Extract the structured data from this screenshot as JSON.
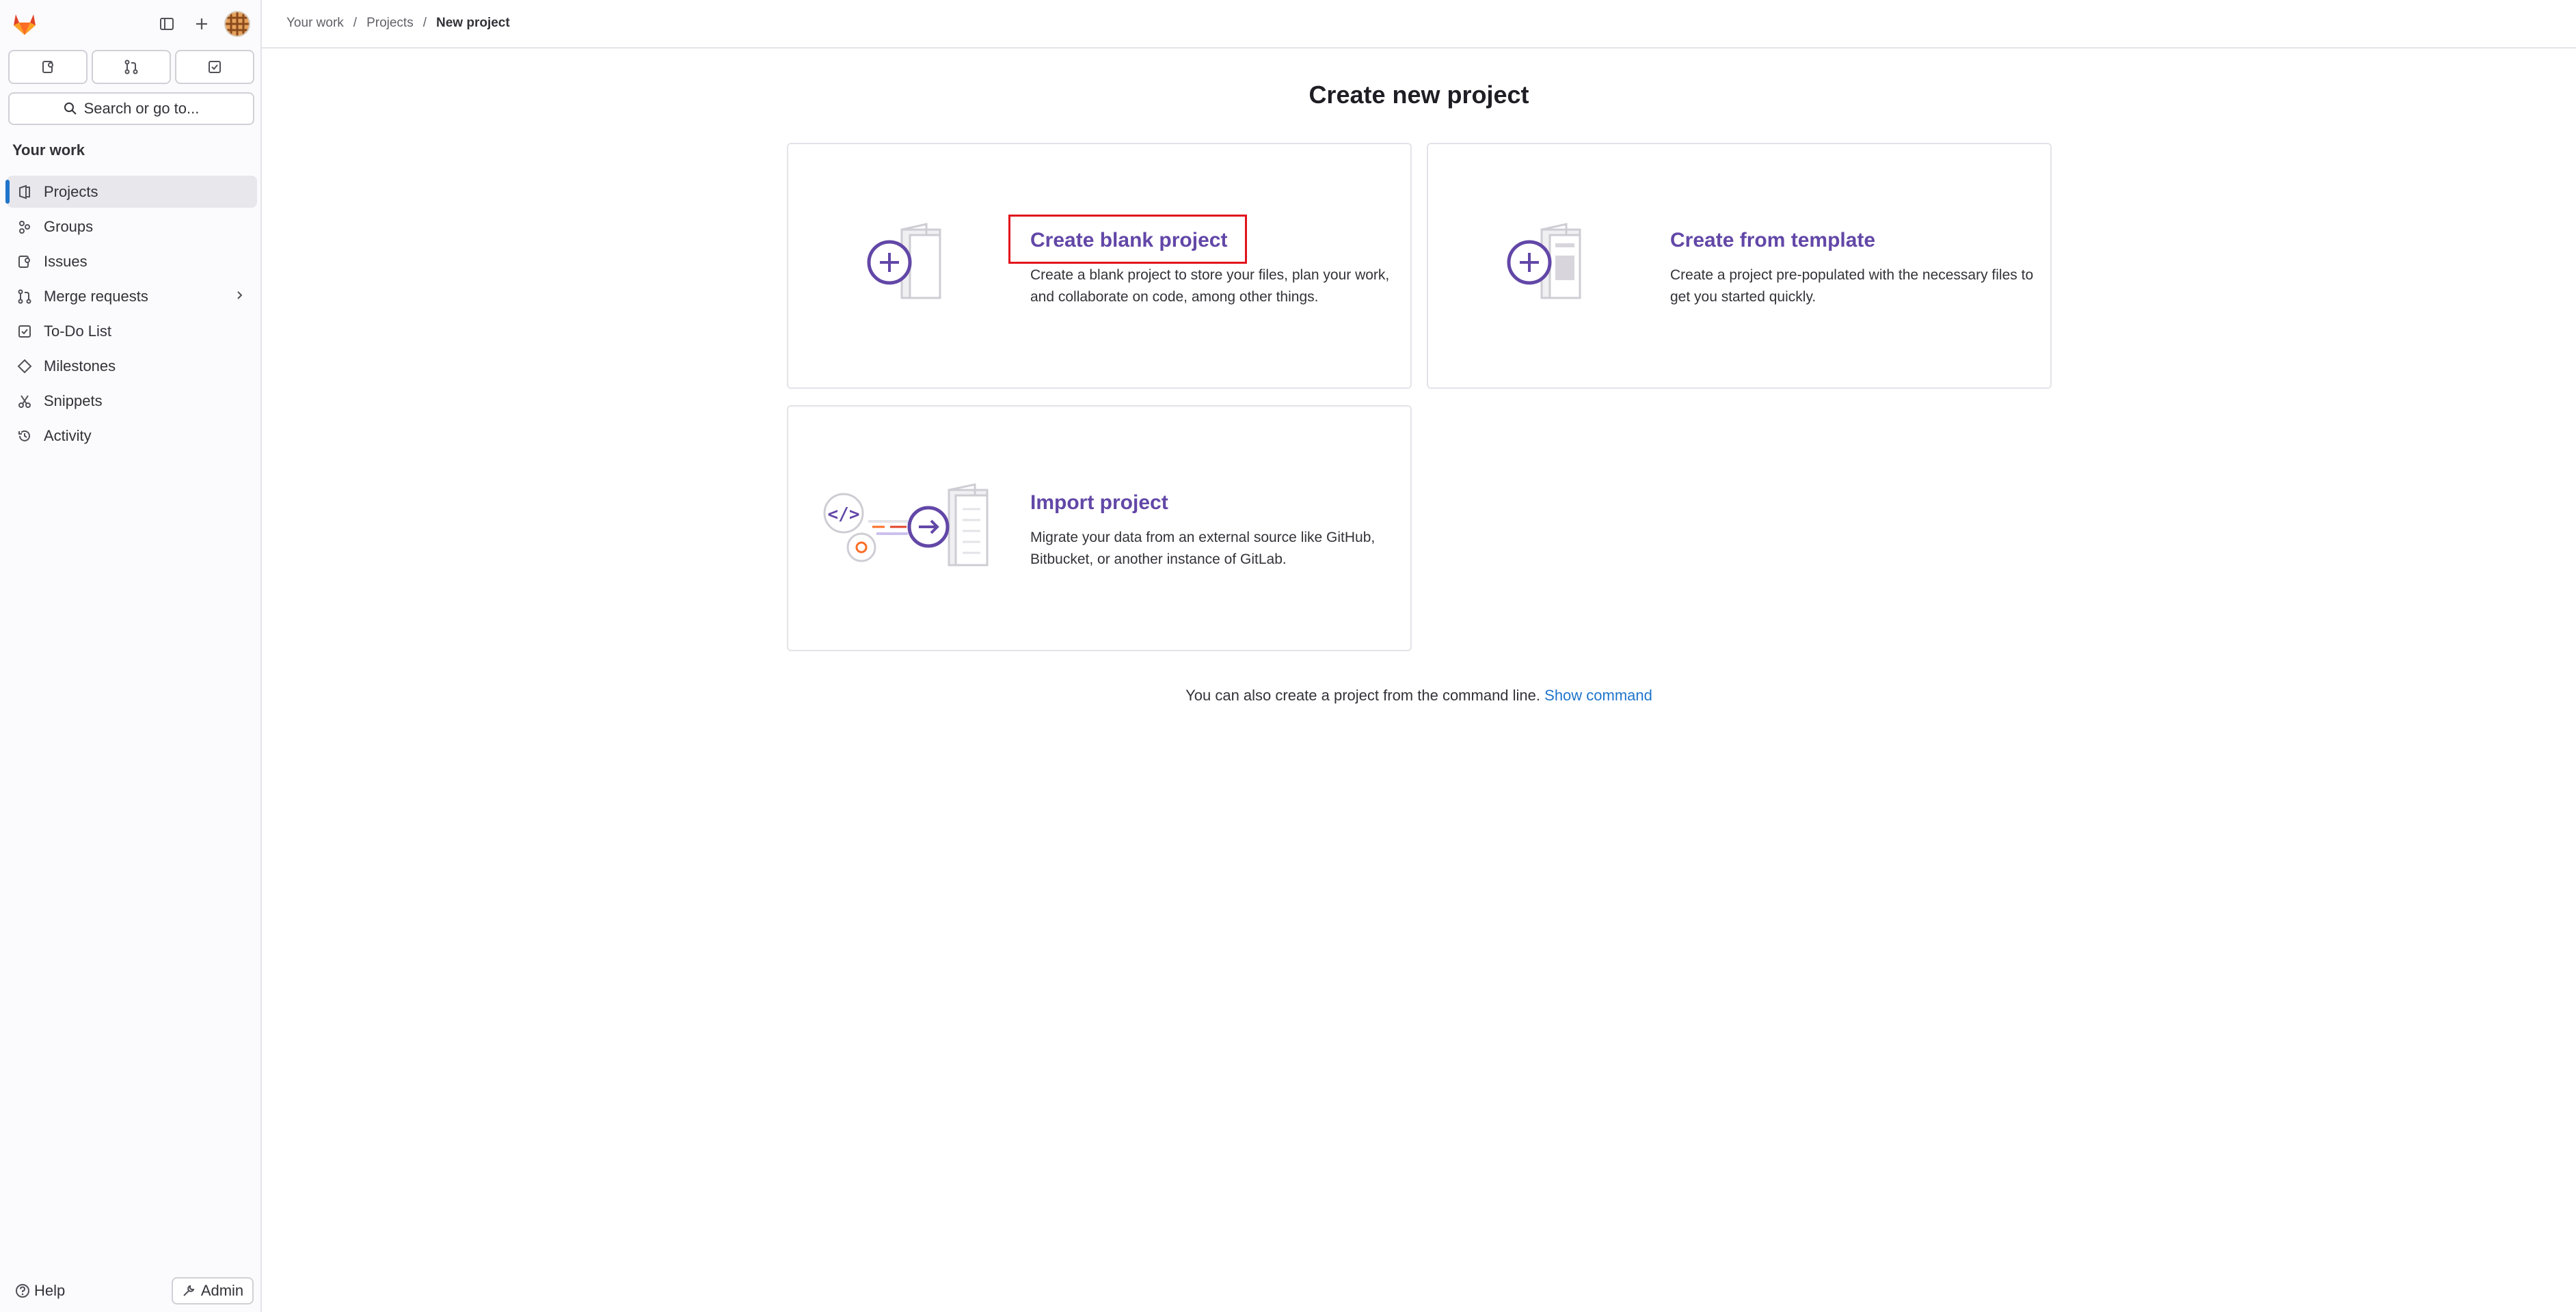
{
  "sidebar": {
    "search_placeholder": "Search or go to...",
    "section_title": "Your work",
    "items": [
      {
        "label": "Projects",
        "icon": "project-icon"
      },
      {
        "label": "Groups",
        "icon": "group-icon"
      },
      {
        "label": "Issues",
        "icon": "issues-icon"
      },
      {
        "label": "Merge requests",
        "icon": "merge-request-icon"
      },
      {
        "label": "To-Do List",
        "icon": "todo-icon"
      },
      {
        "label": "Milestones",
        "icon": "milestone-icon"
      },
      {
        "label": "Snippets",
        "icon": "snippet-icon"
      },
      {
        "label": "Activity",
        "icon": "history-icon"
      }
    ],
    "help_label": "Help",
    "admin_label": "Admin"
  },
  "breadcrumb": {
    "items": [
      "Your work",
      "Projects",
      "New project"
    ]
  },
  "main": {
    "title": "Create new project",
    "cards": [
      {
        "title": "Create blank project",
        "description": "Create a blank project to store your files, plan your work, and collaborate on code, among other things."
      },
      {
        "title": "Create from template",
        "description": "Create a project pre-populated with the necessary files to get you started quickly."
      },
      {
        "title": "Import project",
        "description": "Migrate your data from an external source like GitHub, Bitbucket, or another instance of GitLab."
      }
    ],
    "cmdline_text": "You can also create a project from the command line.",
    "cmdline_link": "Show command"
  },
  "colors": {
    "accent": "#6247a7",
    "link": "#1f75cb",
    "active_indicator": "#1f75cb",
    "highlight": "#e1141c"
  }
}
